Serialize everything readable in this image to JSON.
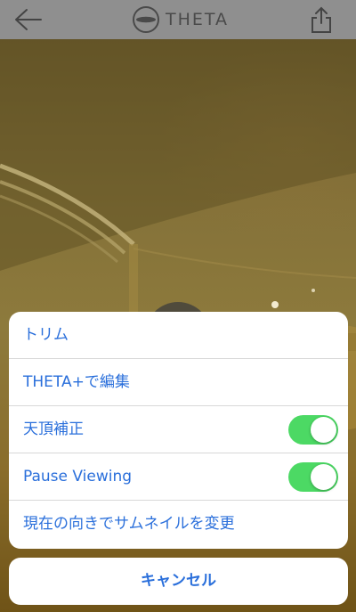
{
  "header": {
    "logo_text": "THETA",
    "back_icon": "arrow-left-icon",
    "share_icon": "share-icon"
  },
  "viewer": {
    "play_icon": "play-icon"
  },
  "action_sheet": {
    "items": [
      {
        "label": "トリム"
      },
      {
        "label": "THETA+で編集"
      },
      {
        "label": "天頂補正",
        "toggle": true,
        "toggle_on": true
      },
      {
        "label": "Pause Viewing",
        "toggle": true,
        "toggle_on": true
      },
      {
        "label": "現在の向きでサムネイルを変更"
      }
    ],
    "cancel_label": "キャンセル"
  },
  "colors": {
    "accent": "#2a6fdb",
    "toggle_on": "#4cd964",
    "navbar": "#8f8f8f"
  }
}
